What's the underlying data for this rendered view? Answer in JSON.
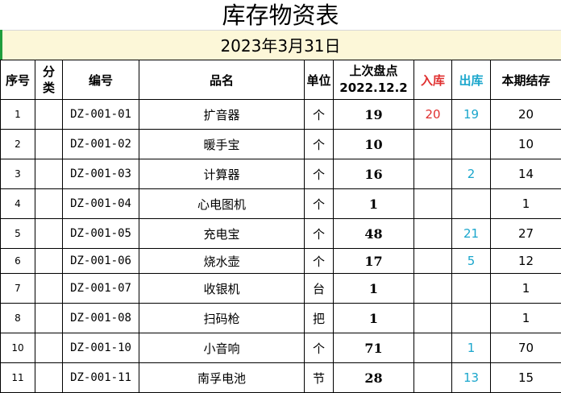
{
  "sheet": {
    "title": "库存物资表",
    "date": "2023年3月31日"
  },
  "headers": {
    "seq": "序号",
    "category_line1": "分",
    "category_line2": "类",
    "code": "编号",
    "name": "品名",
    "unit": "单位",
    "last_count_line1": "上次盘点",
    "last_count_line2": "2022.12.2",
    "stock_in": "入库",
    "stock_out": "出库",
    "balance": "本期结存"
  },
  "colors": {
    "stock_in": "#e03030",
    "stock_out": "#1aa6cc",
    "date_band": "#fcf7d8",
    "selection_marker": "#1f9d3c"
  },
  "rows": [
    {
      "seq": "1",
      "code": "DZ-001-01",
      "name": "扩音器",
      "unit": "个",
      "last": "19",
      "in": "20",
      "out": "19",
      "balance": "20"
    },
    {
      "seq": "2",
      "code": "DZ-001-02",
      "name": "暖手宝",
      "unit": "个",
      "last": "10",
      "in": "",
      "out": "",
      "balance": "10"
    },
    {
      "seq": "3",
      "code": "DZ-001-03",
      "name": "计算器",
      "unit": "个",
      "last": "16",
      "in": "",
      "out": "2",
      "balance": "14"
    },
    {
      "seq": "4",
      "code": "DZ-001-04",
      "name": "心电图机",
      "unit": "个",
      "last": "1",
      "in": "",
      "out": "",
      "balance": "1"
    },
    {
      "seq": "5",
      "code": "DZ-001-05",
      "name": "充电宝",
      "unit": "个",
      "last": "48",
      "in": "",
      "out": "21",
      "balance": "27"
    },
    {
      "seq": "6",
      "code": "DZ-001-06",
      "name": "烧水壶",
      "unit": "个",
      "last": "17",
      "in": "",
      "out": "5",
      "balance": "12"
    },
    {
      "seq": "7",
      "code": "DZ-001-07",
      "name": "收银机",
      "unit": "台",
      "last": "1",
      "in": "",
      "out": "",
      "balance": "1"
    },
    {
      "seq": "8",
      "code": "DZ-001-08",
      "name": "扫码枪",
      "unit": "把",
      "last": "1",
      "in": "",
      "out": "",
      "balance": "1"
    },
    {
      "seq": "10",
      "code": "DZ-001-10",
      "name": "小音响",
      "unit": "个",
      "last": "71",
      "in": "",
      "out": "1",
      "balance": "70"
    },
    {
      "seq": "11",
      "code": "DZ-001-11",
      "name": "南孚电池",
      "unit": "节",
      "last": "28",
      "in": "",
      "out": "13",
      "balance": "15"
    }
  ]
}
